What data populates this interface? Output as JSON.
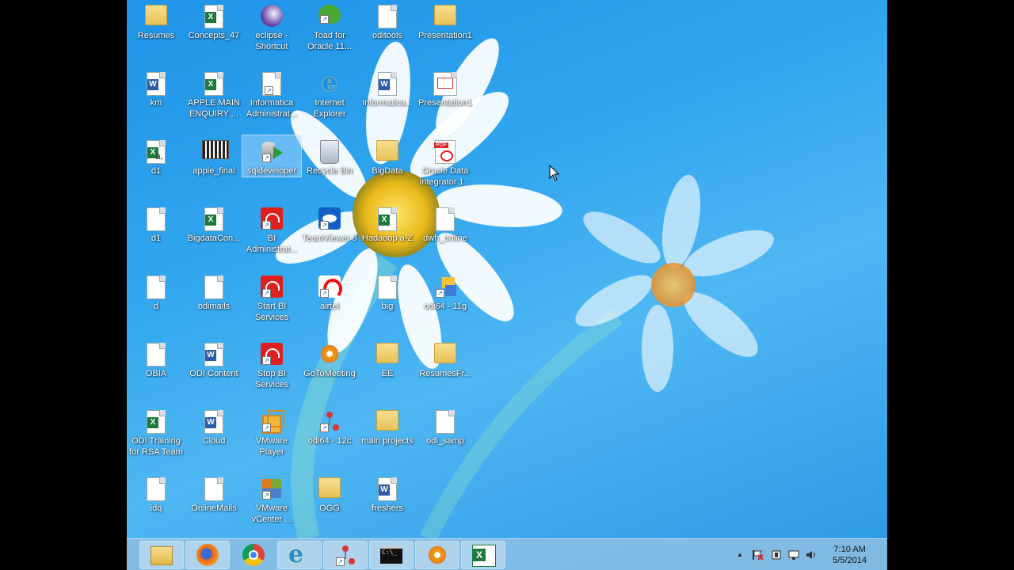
{
  "desktop": {
    "icons": [
      {
        "label": "Resumes",
        "icon": "folder-icon"
      },
      {
        "label": "Concepts_47",
        "icon": "excel-file-icon"
      },
      {
        "label": "eclipse - Shortcut",
        "icon": "eclipse-icon"
      },
      {
        "label": "Toad for Oracle 11...",
        "icon": "toad-icon"
      },
      {
        "label": "oditools",
        "icon": "text-file-icon"
      },
      {
        "label": "Presentation1",
        "icon": "folder-icon"
      },
      {
        "label": "km",
        "icon": "word-file-icon"
      },
      {
        "label": "APPLE MAIN ENQUIRY ...",
        "icon": "excel-file-icon"
      },
      {
        "label": "Informatica Administrat...",
        "icon": "shortcut-file-icon"
      },
      {
        "label": "Internet Explorer",
        "icon": "internet-explorer-icon"
      },
      {
        "label": "Informatica...",
        "icon": "word-file-icon"
      },
      {
        "label": "Presentation1",
        "icon": "powerpoint-file-icon"
      },
      {
        "label": "d1",
        "icon": "excel-csv-icon"
      },
      {
        "label": "apple_final",
        "icon": "image-file-icon"
      },
      {
        "label": "sqldeveloper",
        "icon": "sqldeveloper-icon"
      },
      {
        "label": "Recycle Bin",
        "icon": "recycle-bin-icon"
      },
      {
        "label": "BigData",
        "icon": "folder-icon"
      },
      {
        "label": "Oracle Data Integrator 1...",
        "icon": "pdf-file-icon"
      },
      {
        "label": "d1",
        "icon": "text-file-icon"
      },
      {
        "label": "BigdataCon...",
        "icon": "excel-file-icon"
      },
      {
        "label": "BI Administrat...",
        "icon": "oracle-bi-icon"
      },
      {
        "label": "TeamViewer 8",
        "icon": "teamviewer-icon"
      },
      {
        "label": "Hadaoop a-Z",
        "icon": "excel-file-icon"
      },
      {
        "label": "dwh_online",
        "icon": "text-file-icon"
      },
      {
        "label": "d",
        "icon": "text-file-icon"
      },
      {
        "label": "odimails",
        "icon": "text-file-icon"
      },
      {
        "label": "Start BI Services",
        "icon": "oracle-bi-icon"
      },
      {
        "label": "airtel",
        "icon": "airtel-icon"
      },
      {
        "label": "big",
        "icon": "text-file-icon"
      },
      {
        "label": "odi64 - 11g",
        "icon": "odi-folder-icon"
      },
      {
        "label": "OBIA",
        "icon": "text-file-icon"
      },
      {
        "label": "ODI Content",
        "icon": "word-file-icon"
      },
      {
        "label": "Stop BI Services",
        "icon": "oracle-bi-icon"
      },
      {
        "label": "GoToMeeting",
        "icon": "gotomeeting-icon"
      },
      {
        "label": "EE",
        "icon": "folder-icon"
      },
      {
        "label": "ResumesFr...",
        "icon": "folder-icon"
      },
      {
        "label": "ODI Training for RSA Team",
        "icon": "excel-file-icon"
      },
      {
        "label": "Cloud",
        "icon": "word-file-icon"
      },
      {
        "label": "VMware Player",
        "icon": "vmware-player-icon"
      },
      {
        "label": "odi64 - 12c",
        "icon": "odi-icon"
      },
      {
        "label": "main projects",
        "icon": "folder-icon"
      },
      {
        "label": "odi_samp",
        "icon": "text-file-icon"
      },
      {
        "label": "idq",
        "icon": "text-file-icon"
      },
      {
        "label": "OnlineMails",
        "icon": "text-file-icon"
      },
      {
        "label": "VMware vCenter ...",
        "icon": "vmware-vcenter-icon"
      },
      {
        "label": "OGG",
        "icon": "folder-icon"
      },
      {
        "label": "freshers",
        "icon": "word-file-icon"
      }
    ],
    "selected_label": "sqldeveloper"
  },
  "taskbar": {
    "apps": [
      {
        "name": "File Explorer",
        "icon": "file-explorer-icon"
      },
      {
        "name": "Firefox",
        "icon": "firefox-icon"
      },
      {
        "name": "Chrome",
        "icon": "chrome-icon"
      },
      {
        "name": "Internet Explorer",
        "icon": "internet-explorer-icon"
      },
      {
        "name": "ODI",
        "icon": "odi-icon"
      },
      {
        "name": "Command Prompt",
        "icon": "command-prompt-icon"
      },
      {
        "name": "GoToMeeting",
        "icon": "gotomeeting-icon"
      },
      {
        "name": "Excel",
        "icon": "excel-icon"
      }
    ],
    "tray": {
      "show_hidden": "▲",
      "time": "7:10 AM",
      "date": "5/5/2014"
    }
  }
}
